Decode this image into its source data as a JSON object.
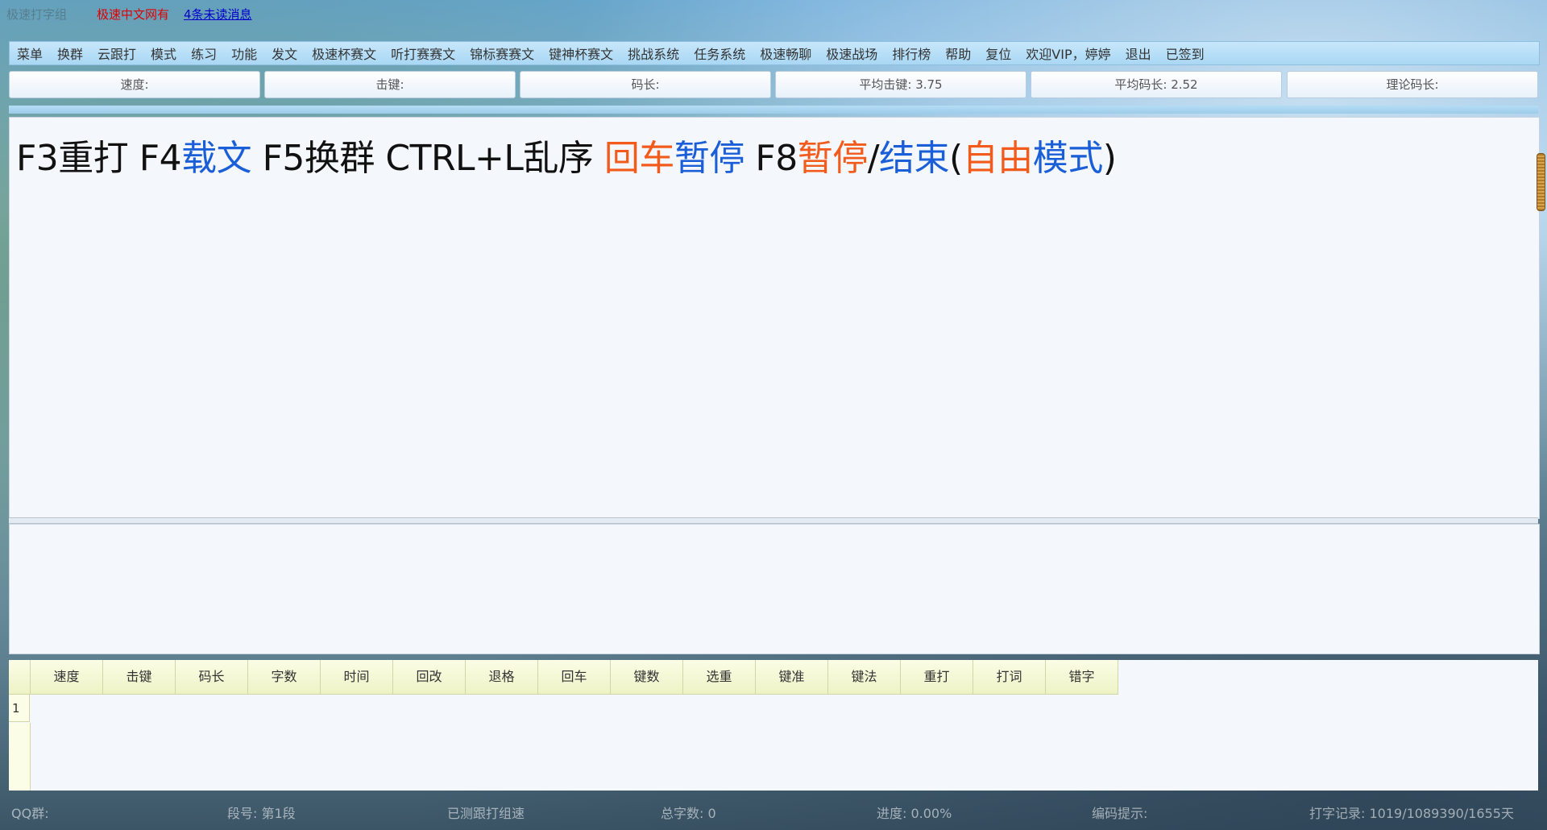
{
  "topbar": {
    "dim_title": "极速打字组",
    "site_name": "极速中文网有",
    "unread_link": "4条未读消息"
  },
  "menu": {
    "items": [
      "菜单",
      "换群",
      "云跟打",
      "模式",
      "练习",
      "功能",
      "发文",
      "极速杯赛文",
      "听打赛赛文",
      "锦标赛赛文",
      "键神杯赛文",
      "挑战系统",
      "任务系统",
      "极速畅聊",
      "极速战场",
      "排行榜",
      "帮助",
      "复位",
      "欢迎VIP，婷婷",
      "退出",
      "已签到"
    ]
  },
  "stats": {
    "speed": "速度:",
    "keystroke": "击键:",
    "code_len": "码长:",
    "avg_keystroke": "平均击键: 3.75",
    "avg_code_len": "平均码长: 2.52",
    "theory_code_len": "理论码长:"
  },
  "text_area": {
    "segments": [
      {
        "text": "F3重打 F4",
        "color": "black"
      },
      {
        "text": "载文",
        "color": "blue"
      },
      {
        "text": " F5换群 CTRL+L乱序 ",
        "color": "black"
      },
      {
        "text": "回车",
        "color": "orange"
      },
      {
        "text": "暂停",
        "color": "blue"
      },
      {
        "text": " F8",
        "color": "black"
      },
      {
        "text": "暂停",
        "color": "orange"
      },
      {
        "text": "/",
        "color": "black"
      },
      {
        "text": "结束",
        "color": "blue"
      },
      {
        "text": "(",
        "color": "black"
      },
      {
        "text": "自由",
        "color": "orange"
      },
      {
        "text": "模式",
        "color": "blue"
      },
      {
        "text": ")",
        "color": "black"
      }
    ]
  },
  "results_table": {
    "columns": [
      "速度",
      "击键",
      "码长",
      "字数",
      "时间",
      "回改",
      "退格",
      "回车",
      "键数",
      "选重",
      "键准",
      "键法",
      "重打",
      "打词",
      "错字"
    ],
    "rows": [
      {
        "num": "1"
      }
    ]
  },
  "statusbar": {
    "qq_group": "QQ群:",
    "segment": "段号: 第1段",
    "hint_a": "已测跟打组速",
    "total_chars": "总字数: 0",
    "progress": "进度: 0.00%",
    "code_hint": "编码提示:",
    "record": "打字记录: 1019/1089390/1655天"
  },
  "colors": {
    "blue": "#1a5ed8",
    "orange": "#f25b1b",
    "menu_bg": "#a9d7f4",
    "table_header": "#eef3c5"
  }
}
